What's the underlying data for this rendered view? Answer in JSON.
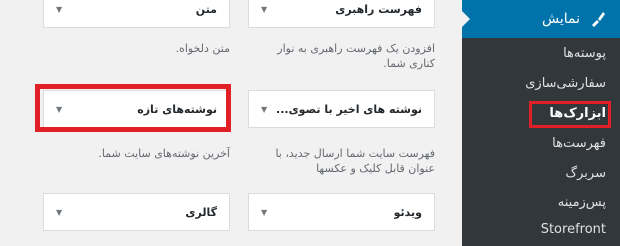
{
  "sidebar": {
    "menu_title": "نمایش",
    "menu_icon": "brush-icon",
    "items": [
      {
        "label": "پوسته‌ها",
        "active": false
      },
      {
        "label": "سفارشی‌سازی",
        "active": false
      },
      {
        "label": "ابزارک‌ها",
        "active": true
      },
      {
        "label": "فهرست‌ها",
        "active": false
      },
      {
        "label": "سربرگ",
        "active": false
      },
      {
        "label": "پس‌زمینه",
        "active": false
      },
      {
        "label": "Storefront",
        "active": false
      }
    ]
  },
  "widgets": {
    "row1": {
      "right": {
        "title": "فهرست راهبری",
        "desc": "افزودن یک فهرست راهبری به نوار کناری شما."
      },
      "left": {
        "title": "متن",
        "desc": "متن دلخواه."
      }
    },
    "row2": {
      "right": {
        "title": "نوشته های اخیر با تصوی...",
        "desc": "فهرست سایت شما ارسال جدید، با عنوان قابل کلیک و عکسها"
      },
      "left": {
        "title": "نوشته‌های تازه",
        "desc": "آخرین نوشته‌های سایت شما."
      }
    },
    "row3": {
      "right": {
        "title": "ویدئو"
      },
      "left": {
        "title": "گالری"
      }
    }
  },
  "colors": {
    "highlight": "#e01f26",
    "menu_active": "#0073aa",
    "sidebar_bg": "#23282d"
  }
}
